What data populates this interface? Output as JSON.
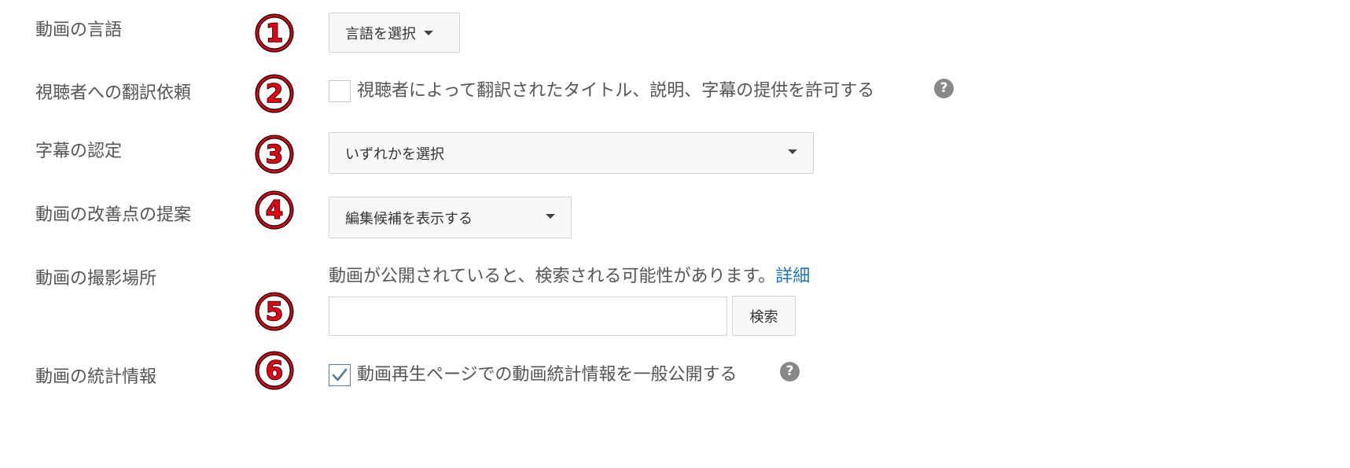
{
  "rows": {
    "language": {
      "label": "動画の言語",
      "badge": "1",
      "button_label": "言語を選択"
    },
    "translation": {
      "label": "視聴者への翻訳依頼",
      "badge": "2",
      "checkbox_checked": false,
      "checkbox_label": "視聴者によって翻訳されたタイトル、説明、字幕の提供を許可する",
      "help_icon": "?"
    },
    "caption_cert": {
      "label": "字幕の認定",
      "badge": "3",
      "select_value": "いずれかを選択"
    },
    "improvements": {
      "label": "動画の改善点の提案",
      "badge": "4",
      "select_value": "編集候補を表示する"
    },
    "location": {
      "label": "動画の撮影場所",
      "badge": "5",
      "info_text": "動画が公開されていると、検索される可能性があります。",
      "info_link": "詳細",
      "input_value": "",
      "search_button": "検索"
    },
    "stats": {
      "label": "動画の統計情報",
      "badge": "6",
      "checkbox_checked": true,
      "checkbox_label": "動画再生ページでの動画統計情報を一般公開する",
      "help_icon": "?"
    }
  },
  "colors": {
    "badge_fill": "#e60012",
    "badge_outline": "#000000",
    "link": "#1a74c4",
    "label_text": "#555555"
  }
}
